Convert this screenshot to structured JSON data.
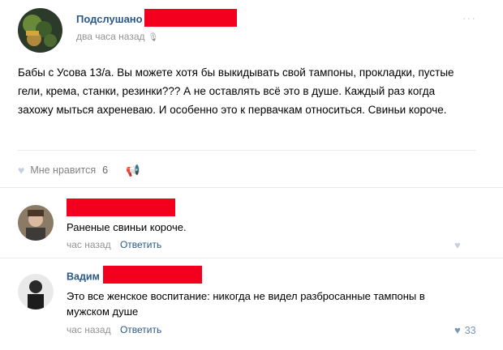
{
  "post": {
    "author": "Подслушано",
    "time": "два часа назад",
    "text": "Бабы с Усова 13/а. Вы можете хотя бы выкидывать свой тампоны, прокладки, пустые гели, крема, станки, резинки??? А не оставлять всё это в душе. Каждый раз когда захожу мыться ахреневаю. И особенно это к первачкам относиться. Свиньи короче.",
    "likes_label": "Мне нравится",
    "likes_count": "6"
  },
  "comments": [
    {
      "author": "",
      "text": "Раненые свиньи короче.",
      "time": "час назад",
      "reply_label": "Ответить",
      "likes": ""
    },
    {
      "author": "Вадим",
      "text": "Это все женское воспитание: никогда не видел разбросанные тампоны в мужском душе",
      "time": "час назад",
      "reply_label": "Ответить",
      "likes": "33"
    }
  ],
  "colors": {
    "link": "#2a5885",
    "muted": "#939393",
    "redaction": "#f2001d",
    "like_active": "#7996b2"
  },
  "icons": {
    "mic": "microphone-icon",
    "menu": "more-dots-icon",
    "heart": "heart-icon",
    "share": "megaphone-icon"
  }
}
